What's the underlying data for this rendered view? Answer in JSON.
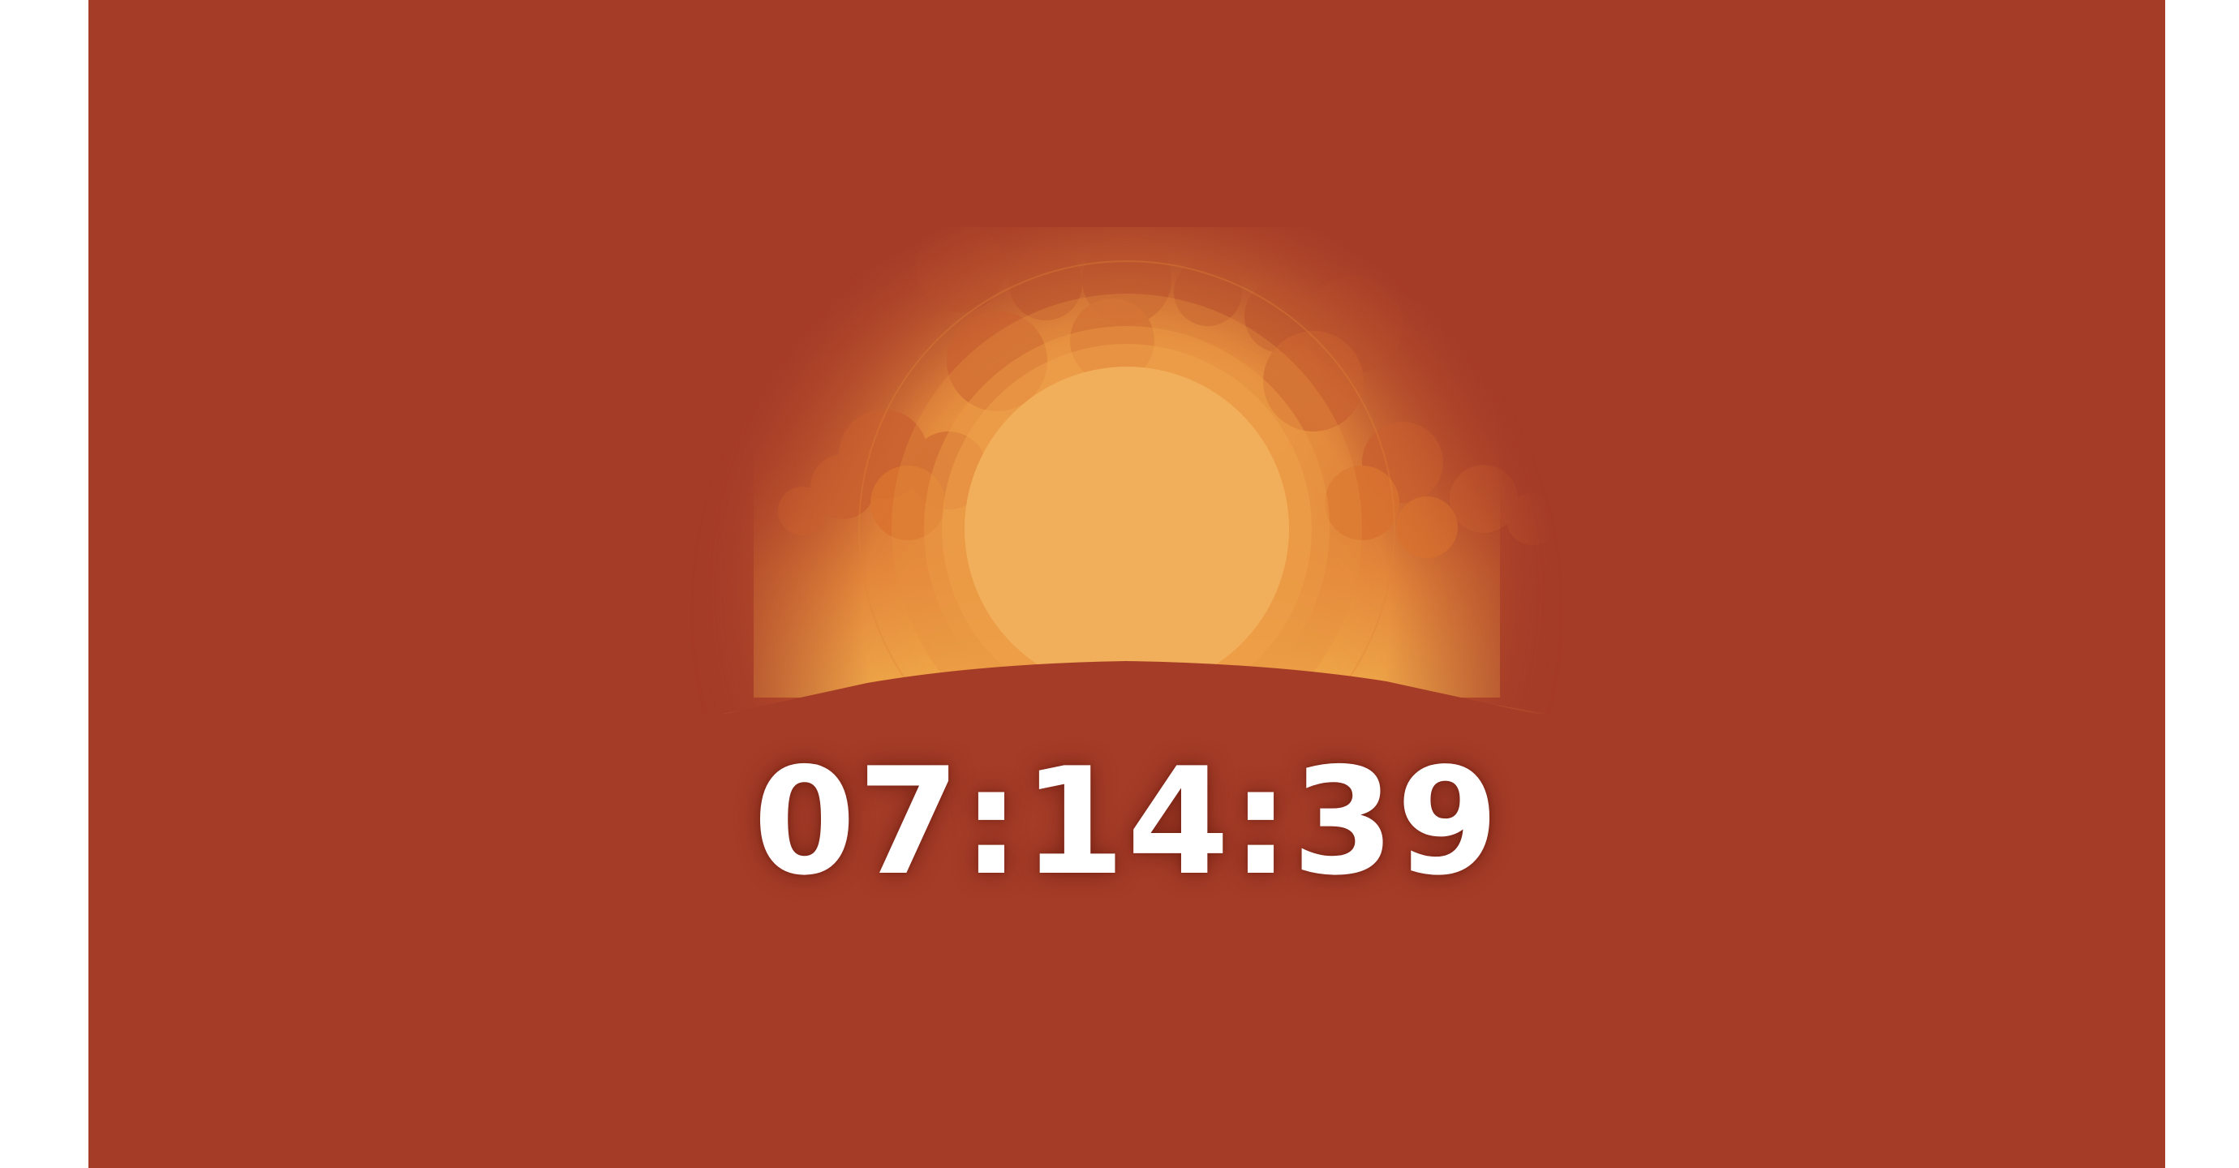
{
  "scene": {
    "colors": {
      "background": "#a53c28",
      "sun": "#f2af5b",
      "glow_inner": "#f0a24a",
      "glow_outer": "#e07a35",
      "cloud": "#c9602f",
      "ground": "#a53c28"
    },
    "icons": [
      "sun-icon",
      "cloud-bank",
      "horizon-hill"
    ]
  },
  "clock": {
    "time": "07:14:39",
    "color": "#ffffff"
  }
}
